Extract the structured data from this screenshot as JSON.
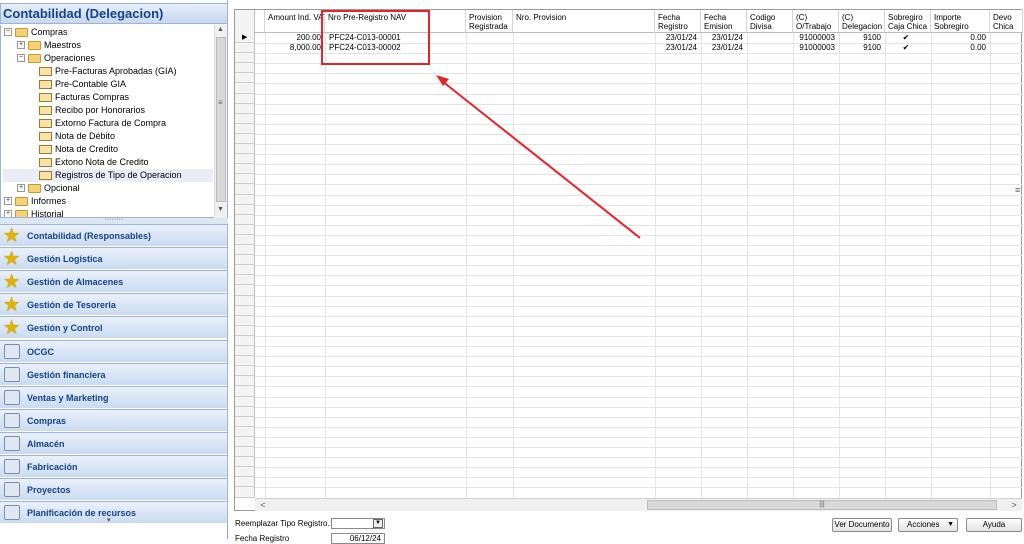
{
  "left_panel": {
    "title": "Contabilidad (Delegacion)",
    "tree": [
      {
        "label": "Compras",
        "level": 0,
        "expander": "−",
        "icon": "folder-open-icon"
      },
      {
        "label": "Maestros",
        "level": 1,
        "expander": "+",
        "icon": "folder-icon"
      },
      {
        "label": "Operaciones",
        "level": 1,
        "expander": "−",
        "icon": "folder-open-icon"
      },
      {
        "label": "Pre-Facturas Aprobadas (GIA)",
        "level": 2,
        "icon": "form-icon"
      },
      {
        "label": "Pre-Contable GIA",
        "level": 2,
        "icon": "form-icon"
      },
      {
        "label": "Facturas Compras",
        "level": 2,
        "icon": "form-icon"
      },
      {
        "label": "Recibo por Honorarios",
        "level": 2,
        "icon": "form-icon"
      },
      {
        "label": "Extorno Factura de Compra",
        "level": 2,
        "icon": "form-icon"
      },
      {
        "label": "Nota de Débito",
        "level": 2,
        "icon": "form-icon"
      },
      {
        "label": "Nota de Credito",
        "level": 2,
        "icon": "form-icon"
      },
      {
        "label": "Extono Nota de Credito",
        "level": 2,
        "icon": "form-icon"
      },
      {
        "label": "Registros de Tipo de Operacion",
        "level": 2,
        "icon": "form-icon",
        "selected": true
      },
      {
        "label": "Opcional",
        "level": 1,
        "expander": "+",
        "icon": "folder-icon"
      },
      {
        "label": "Informes",
        "level": 0,
        "expander": "+",
        "icon": "folder-icon"
      },
      {
        "label": "Historial",
        "level": 0,
        "expander": "+",
        "icon": "folder-icon"
      }
    ],
    "modules": [
      {
        "label": "Contabilidad (Responsables)",
        "icon": "star-icon"
      },
      {
        "label": "Gestión Logística",
        "icon": "star-icon"
      },
      {
        "label": "Gestión de Almacenes",
        "icon": "star-icon"
      },
      {
        "label": "Gestión de Tesoreria",
        "icon": "star-icon"
      },
      {
        "label": "Gestión y Control",
        "icon": "star-icon"
      },
      {
        "label": "OCGC",
        "icon": "module-icon"
      },
      {
        "label": "Gestión financiera",
        "icon": "module-icon"
      },
      {
        "label": "Ventas y Marketing",
        "icon": "module-icon"
      },
      {
        "label": "Compras",
        "icon": "module-icon"
      },
      {
        "label": "Almacén",
        "icon": "module-icon"
      },
      {
        "label": "Fabricación",
        "icon": "module-icon"
      },
      {
        "label": "Proyectos",
        "icon": "module-icon"
      },
      {
        "label": "Planificación de recursos",
        "icon": "module-icon"
      }
    ]
  },
  "grid": {
    "columns": [
      "Amount Ind. VAT",
      "Nro Pre-Registro NAV",
      "Provision\nRegistrada",
      "Nro. Provision",
      "Fecha\nRegistro",
      "Fecha\nEmision",
      "Codigo\nDivisa",
      "(C)\nO/Trabajo",
      "(C)\nDelegacion",
      "Sobregiro\nCaja Chica",
      "Importe\nSobregiro",
      "Devo\nChica"
    ],
    "rows": [
      {
        "amount": "200.00",
        "nro_pre_registro": "PFC24-C013-00001",
        "fecha_registro": "23/01/24",
        "fecha_emision": "23/01/24",
        "o_trabajo": "91000003",
        "delegacion": "9100",
        "sobregiro": "✔",
        "importe": "0.00"
      },
      {
        "amount": "8,000.00",
        "nro_pre_registro": "PFC24-C013-00002",
        "fecha_registro": "23/01/24",
        "fecha_emision": "23/01/24",
        "o_trabajo": "91000003",
        "delegacion": "9100",
        "sobregiro": "✔",
        "importe": "0.00"
      }
    ],
    "current_row_marker": "▶"
  },
  "bottom": {
    "reemplazar_label": "Reemplazar Tipo Registro.",
    "fecha_label": "Fecha Registro",
    "fecha_value": "06/12/24",
    "btn_ver_documento": "Ver Documento",
    "btn_acciones": "Acciones",
    "btn_ayuda": "Ayuda"
  },
  "annotation": {
    "color": "#e8242a"
  }
}
